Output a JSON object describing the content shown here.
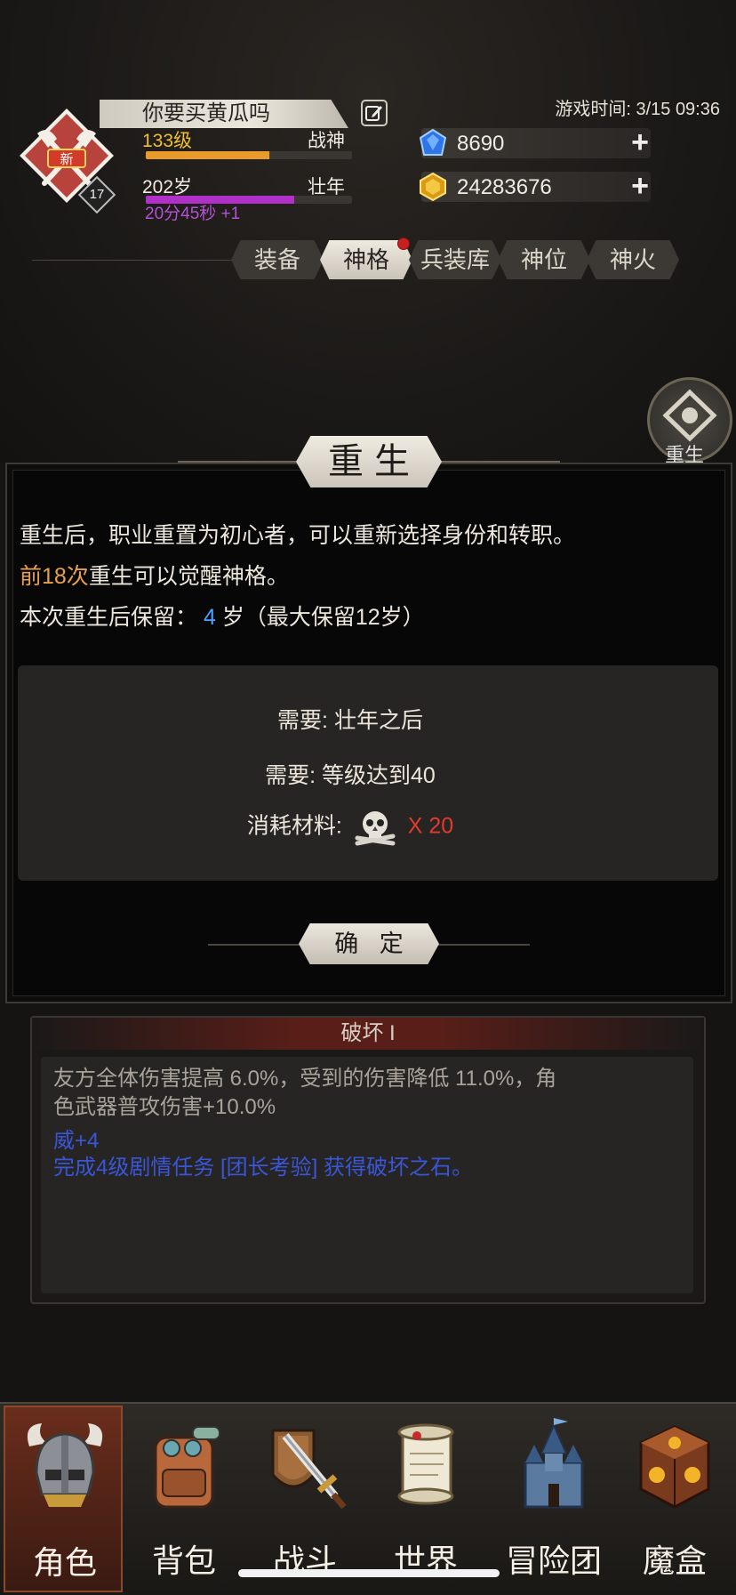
{
  "header": {
    "player_name": "你要买黄瓜吗",
    "level_text": "133级",
    "level_title": "战神",
    "level_progress": 0.6,
    "age_text": "202岁",
    "age_stage": "壮年",
    "age_progress": 0.72,
    "timer_text": "20分45秒 +1",
    "emblem_badge_text": "新",
    "emblem_level": "17",
    "game_time": "游戏时间: 3/15 09:36"
  },
  "resources": {
    "diamond": "8690",
    "gold": "24283676"
  },
  "tabs": [
    "装备",
    "神格",
    "兵装库",
    "神位",
    "神火"
  ],
  "side_button": {
    "label": "重生"
  },
  "dialog": {
    "title": "重生",
    "line1": "重生后，职业重置为初心者，可以重新选择身份和转职。",
    "line2_highlight": "前18次",
    "line2_rest": "重生可以觉醒神格。",
    "line3_prefix": "本次重生后保留：",
    "line3_value": "4",
    "line3_suffix": "岁（最大保留12岁）",
    "req1": "需要: 壮年之后",
    "req2": "需要: 等级达到40",
    "material_label": "消耗材料:",
    "material_cost": "X 20",
    "confirm": "确 定"
  },
  "description": {
    "title": "破坏 I",
    "line1": "友方全体伤害提高 6.0%，受到的伤害降低 11.0%，角",
    "line2": "色武器普攻伤害+10.0%",
    "line3": "威+4",
    "line4": "完成4级剧情任务 [团长考验] 获得破坏之石。"
  },
  "nav": {
    "items": [
      "角色",
      "背包",
      "战斗",
      "世界",
      "冒险团",
      "魔盒"
    ],
    "active": "角色"
  },
  "colors": {
    "level_bar": "#e89a2a",
    "age_bar": "#b030c8",
    "highlight_orange": "#e8a14a",
    "highlight_blue": "#4aa3ff",
    "cost_red": "#e23a2c",
    "desc_gray": "#a9a39a",
    "desc_blue": "#3a56d8"
  }
}
